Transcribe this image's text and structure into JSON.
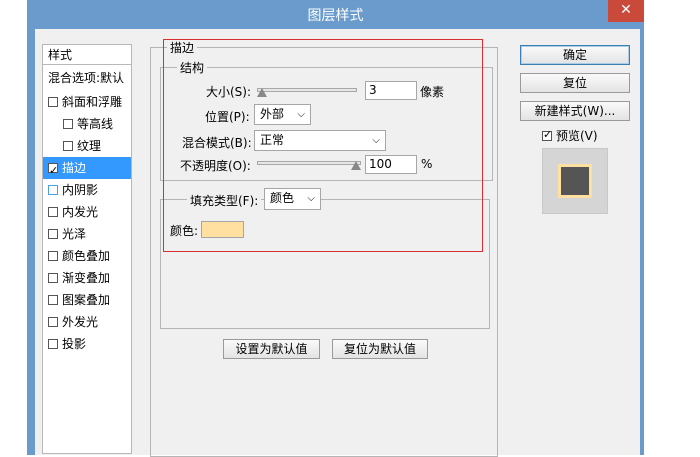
{
  "window": {
    "title": "图层样式",
    "close_glyph": "✕"
  },
  "sidebar": {
    "header": "样式",
    "blend_options": "混合选项:默认",
    "items": [
      {
        "label": "斜面和浮雕",
        "checked": false,
        "indent": false
      },
      {
        "label": "等高线",
        "checked": false,
        "indent": true
      },
      {
        "label": "纹理",
        "checked": false,
        "indent": true
      },
      {
        "label": "描边",
        "checked": true,
        "indent": false,
        "selected": true
      },
      {
        "label": "内阴影",
        "checked": false,
        "indent": false
      },
      {
        "label": "内发光",
        "checked": false,
        "indent": false
      },
      {
        "label": "光泽",
        "checked": false,
        "indent": false
      },
      {
        "label": "颜色叠加",
        "checked": false,
        "indent": false
      },
      {
        "label": "渐变叠加",
        "checked": false,
        "indent": false
      },
      {
        "label": "图案叠加",
        "checked": false,
        "indent": false
      },
      {
        "label": "外发光",
        "checked": false,
        "indent": false
      },
      {
        "label": "投影",
        "checked": false,
        "indent": false
      }
    ]
  },
  "stroke": {
    "group_title": "描边",
    "structure_title": "结构",
    "size_label": "大小(S):",
    "size_value": "3",
    "size_unit": "像素",
    "position_label": "位置(P):",
    "position_value": "外部",
    "blend_label": "混合模式(B):",
    "blend_value": "正常",
    "opacity_label": "不透明度(O):",
    "opacity_value": "100",
    "opacity_unit": "%",
    "fill_type_label": "填充类型(F):",
    "fill_type_value": "颜色",
    "color_label": "颜色:",
    "stroke_color": "#ffe0a0"
  },
  "footer": {
    "set_default": "设置为默认值",
    "reset_default": "复位为默认值"
  },
  "right": {
    "ok": "确定",
    "reset": "复位",
    "new_style": "新建样式(W)...",
    "preview_label": "预览(V)",
    "preview_checked": true
  }
}
